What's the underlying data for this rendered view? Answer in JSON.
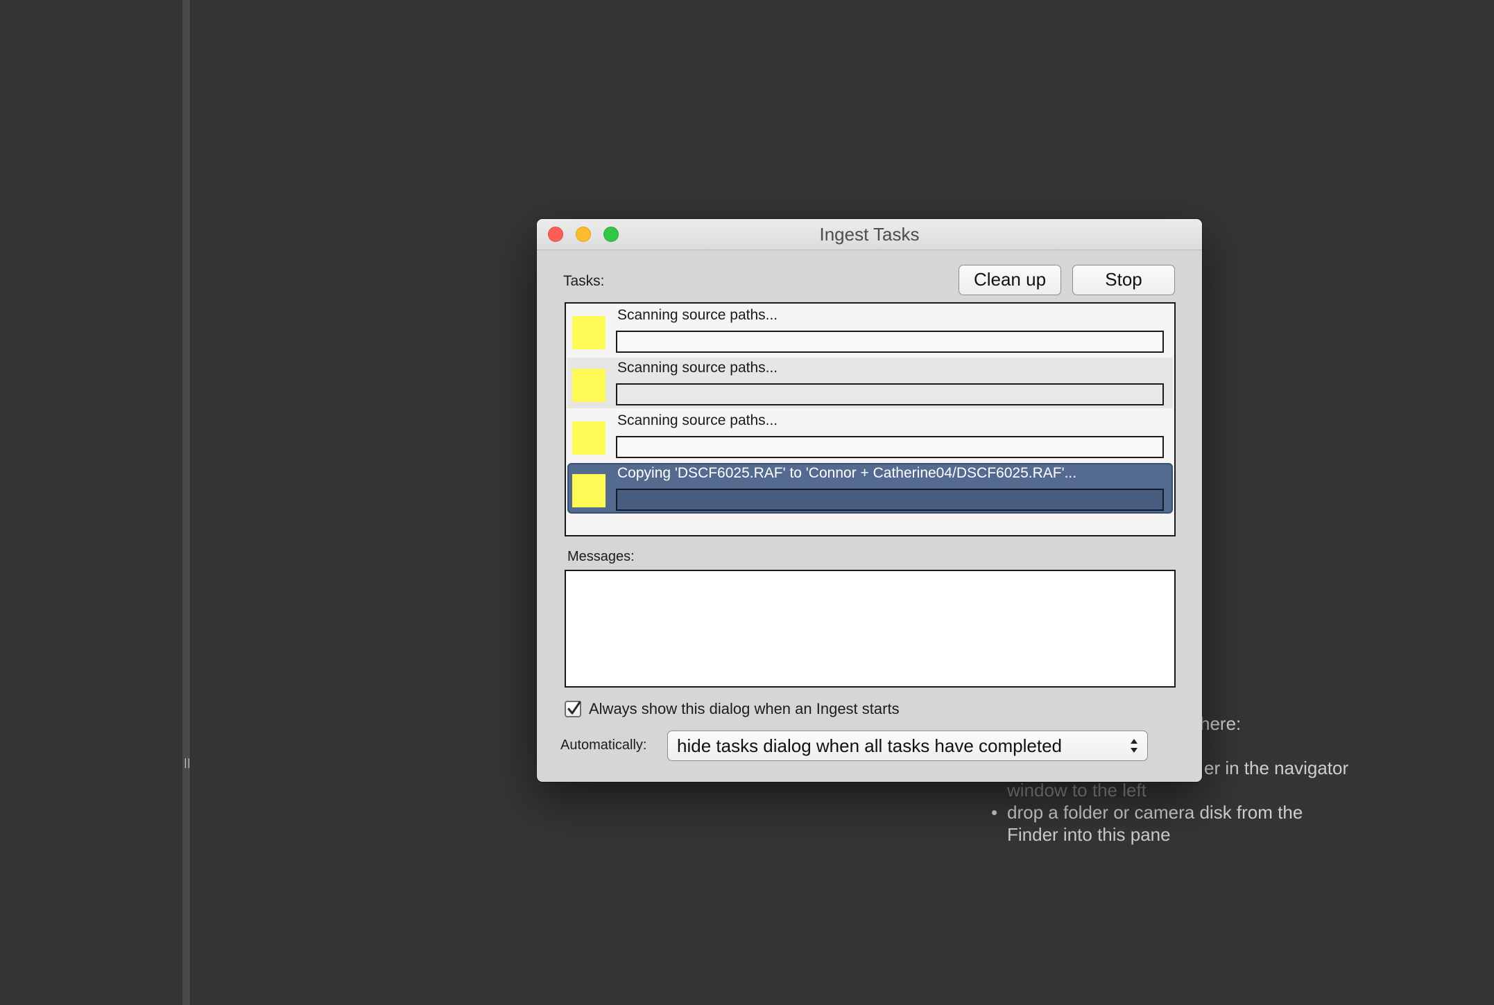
{
  "background": {
    "hint_lines": [
      {
        "text": "here:"
      },
      {
        "text": "er in the navigator"
      },
      {
        "text": "window to the left"
      },
      {
        "text": "drop a folder or camera disk from the"
      },
      {
        "text": "Finder into this pane"
      }
    ],
    "splitter_grip": "||"
  },
  "dialog": {
    "title": "Ingest Tasks",
    "tasks_label": "Tasks:",
    "clean_up_label": "Clean up",
    "stop_label": "Stop",
    "tasks": [
      {
        "text": "Scanning source paths...",
        "progress": 0
      },
      {
        "text": "Scanning source paths...",
        "progress": 0
      },
      {
        "text": "Scanning source paths...",
        "progress": 0
      },
      {
        "text": "Copying 'DSCF6025.RAF' to 'Connor + Catherine04/DSCF6025.RAF'...",
        "progress": 0,
        "selected": true
      }
    ],
    "messages_label": "Messages:",
    "always_show_label": "Always show this dialog when an Ingest starts",
    "always_show_checked": true,
    "automatically_label": "Automatically:",
    "automatically_value": "hide tasks dialog when all tasks have completed"
  },
  "colors": {
    "task_icon": "#fdfa55",
    "selection": "#546a8e",
    "close": "#fc5f57",
    "minimize": "#fdbc2e",
    "zoom": "#33c748"
  }
}
